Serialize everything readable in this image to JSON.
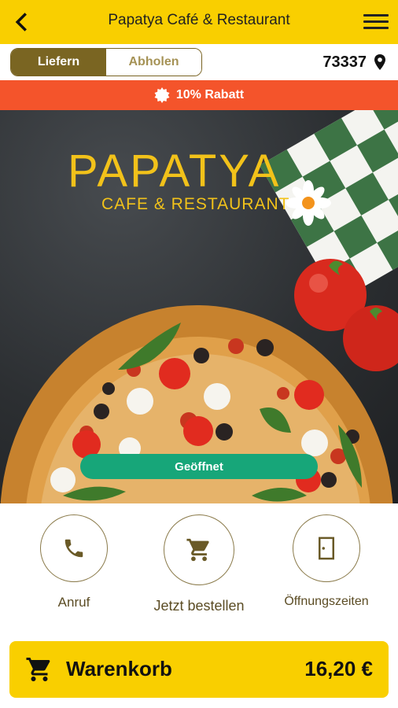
{
  "header": {
    "title": "Papatya Café & Restaurant"
  },
  "mode": {
    "deliver_label": "Liefern",
    "pickup_label": "Abholen",
    "zip": "73337"
  },
  "promo": {
    "text": "10% Rabatt"
  },
  "hero": {
    "brand": "PAPATYA",
    "subtitle": "CAFE & RESTAURANT",
    "status": "Geöffnet"
  },
  "actions": [
    {
      "label": "Anruf",
      "icon": "phone-icon"
    },
    {
      "label": "Jetzt bestellen",
      "icon": "cart-icon"
    },
    {
      "label": "Öffnungszeiten",
      "icon": "door-icon"
    }
  ],
  "cart": {
    "label": "Warenkorb",
    "total": "16,20 €"
  },
  "colors": {
    "primary_yellow": "#f9cf00",
    "accent_brown": "#7a6522",
    "promo_orange": "#f4542b",
    "status_green": "#17a679"
  }
}
